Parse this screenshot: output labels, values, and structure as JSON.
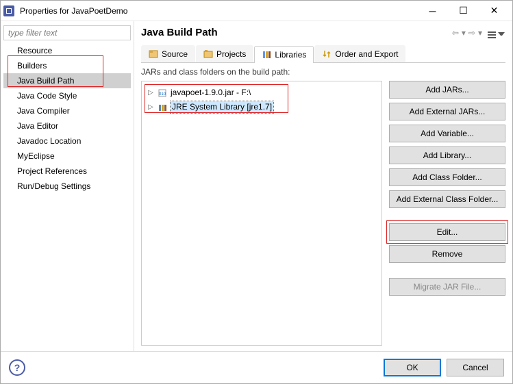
{
  "window": {
    "title": "Properties for JavaPoetDemo"
  },
  "filter": {
    "placeholder": "type filter text"
  },
  "categories": [
    {
      "label": "Resource"
    },
    {
      "label": "Builders"
    },
    {
      "label": "Java Build Path",
      "selected": true
    },
    {
      "label": "Java Code Style"
    },
    {
      "label": "Java Compiler"
    },
    {
      "label": "Java Editor"
    },
    {
      "label": "Javadoc Location"
    },
    {
      "label": "MyEclipse"
    },
    {
      "label": "Project References"
    },
    {
      "label": "Run/Debug Settings"
    }
  ],
  "page": {
    "title": "Java Build Path",
    "subLabel": "JARs and class folders on the build path:"
  },
  "tabs": [
    {
      "label": "Source",
      "icon": "source-icon"
    },
    {
      "label": "Projects",
      "icon": "projects-icon"
    },
    {
      "label": "Libraries",
      "icon": "libraries-icon",
      "active": true
    },
    {
      "label": "Order and Export",
      "icon": "order-icon"
    }
  ],
  "tree": [
    {
      "label": "javapoet-1.9.0.jar - F:\\",
      "icon": "jar"
    },
    {
      "label": "JRE System Library [jre1.7]",
      "icon": "lib",
      "selected": true
    }
  ],
  "buttons": {
    "addJars": "Add JARs...",
    "addExtJars": "Add External JARs...",
    "addVar": "Add Variable...",
    "addLib": "Add Library...",
    "addClassFolder": "Add Class Folder...",
    "addExtClassFolder": "Add External Class Folder...",
    "edit": "Edit...",
    "remove": "Remove",
    "migrate": "Migrate JAR File..."
  },
  "footer": {
    "ok": "OK",
    "cancel": "Cancel"
  }
}
